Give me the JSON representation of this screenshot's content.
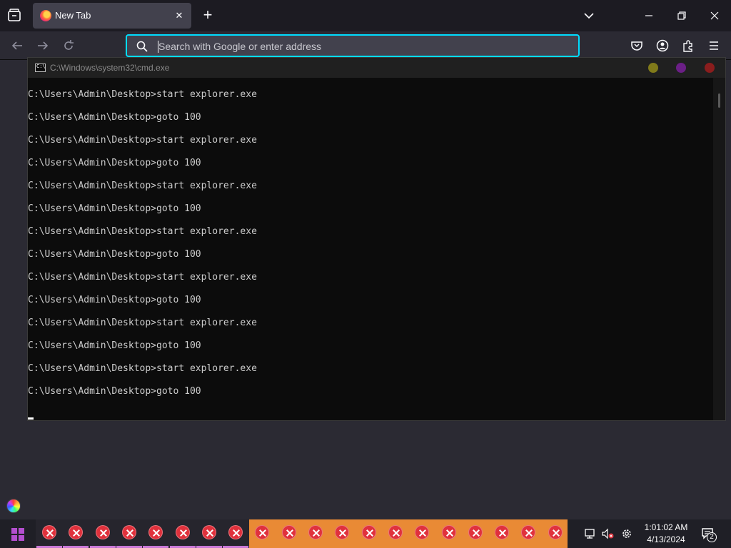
{
  "browser": {
    "tab": {
      "title": "New Tab"
    },
    "urlbar": {
      "placeholder": "Search with Google or enter address"
    },
    "accent": "#00ddff"
  },
  "cmd": {
    "title": "C:\\Windows\\system32\\cmd.exe",
    "icon_text": "C:\\",
    "lines": [
      "C:\\Users\\Admin\\Desktop>start explorer.exe",
      "C:\\Users\\Admin\\Desktop>goto 100",
      "C:\\Users\\Admin\\Desktop>start explorer.exe",
      "C:\\Users\\Admin\\Desktop>goto 100",
      "C:\\Users\\Admin\\Desktop>start explorer.exe",
      "C:\\Users\\Admin\\Desktop>goto 100",
      "C:\\Users\\Admin\\Desktop>start explorer.exe",
      "C:\\Users\\Admin\\Desktop>goto 100",
      "C:\\Users\\Admin\\Desktop>start explorer.exe",
      "C:\\Users\\Admin\\Desktop>goto 100",
      "C:\\Users\\Admin\\Desktop>start explorer.exe",
      "C:\\Users\\Admin\\Desktop>goto 100",
      "C:\\Users\\Admin\\Desktop>start explorer.exe",
      "C:\\Users\\Admin\\Desktop>goto 100"
    ],
    "dot_colors": [
      "#807a1a",
      "#6b1f86",
      "#8a1d1d"
    ]
  },
  "taskbar": {
    "app_icon": "error-x-icon",
    "app_count": 20,
    "orange_color": "#e98a35",
    "clock": {
      "time": "1:01:02 AM",
      "date": "4/13/2024"
    },
    "notification_count": "2"
  }
}
